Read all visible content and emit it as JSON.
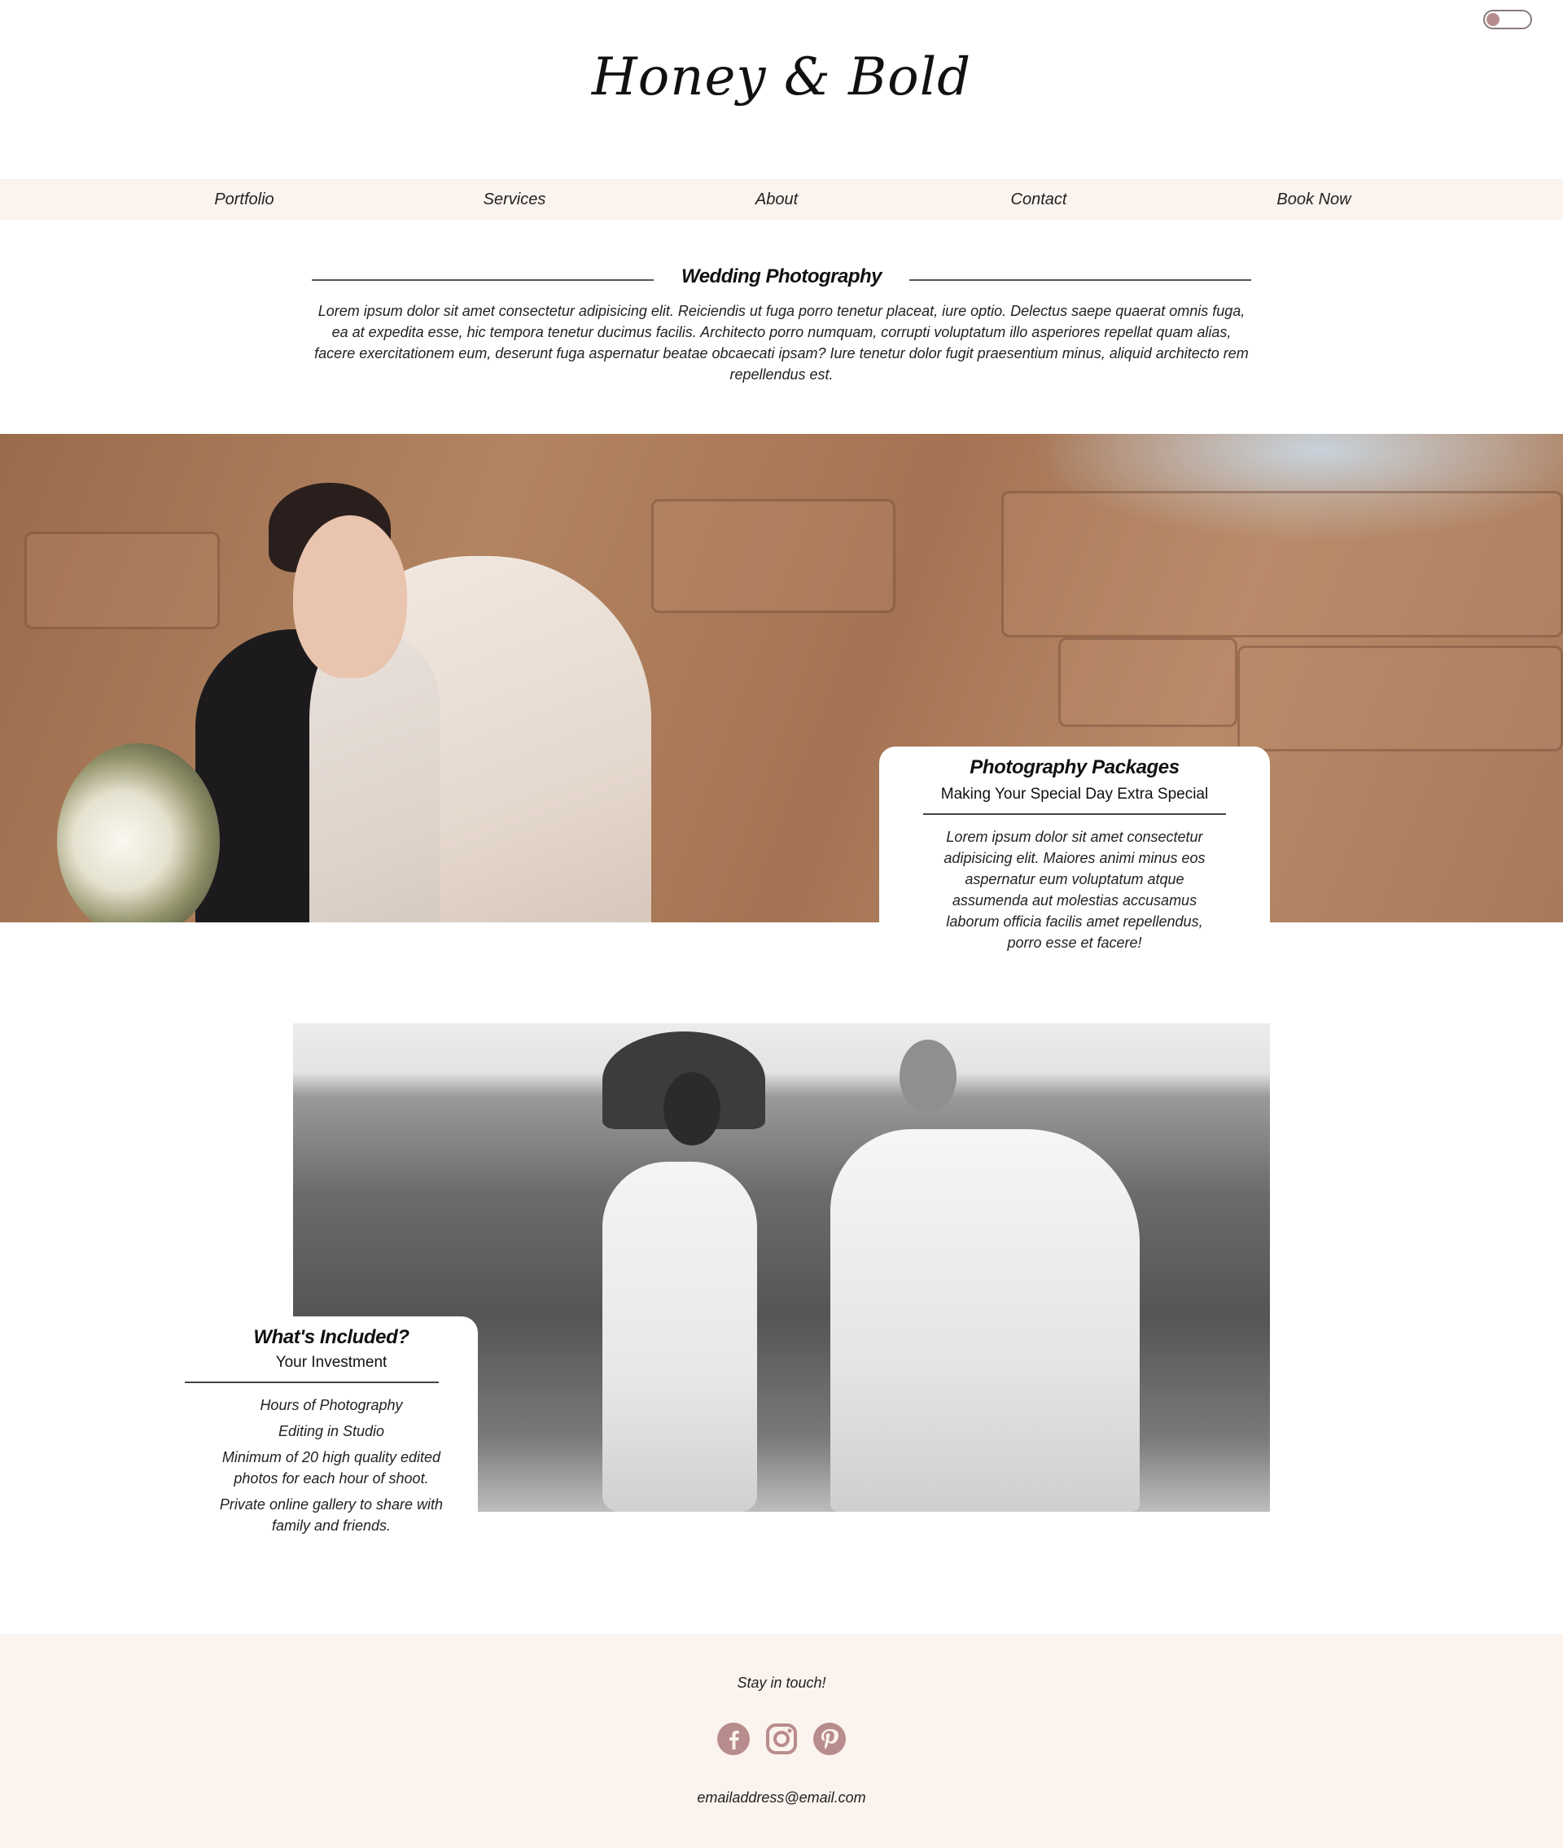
{
  "header": {
    "logo": "Honey & Bold",
    "theme_toggle_icon": "toggle-switch-icon"
  },
  "nav": {
    "items": [
      {
        "label": "Portfolio"
      },
      {
        "label": "Services"
      },
      {
        "label": "About"
      },
      {
        "label": "Contact"
      },
      {
        "label": "Book Now"
      }
    ]
  },
  "intro": {
    "title": "Wedding Photography",
    "body": "Lorem ipsum dolor sit amet consectetur adipisicing elit. Reiciendis ut fuga porro tenetur placeat, iure optio. Delectus saepe quaerat omnis fuga, ea at expedita esse, hic tempora tenetur ducimus facilis. Architecto porro numquam, corrupti voluptatum illo asperiores repellat quam alias, facere exercitationem eum, deserunt fuga aspernatur beatae obcaecati ipsam? Iure tenetur dolor fugit praesentium minus, aliquid architecto rem repellendus est."
  },
  "packages": {
    "title": "Photography Packages",
    "subtitle": "Making Your Special Day Extra Special",
    "body": "Lorem ipsum dolor sit amet consectetur adipisicing elit. Maiores animi minus eos aspernatur eum voluptatum atque assumenda aut molestias accusamus laborum officia facilis amet repellendus, porro esse et facere!"
  },
  "included": {
    "title": "What's Included?",
    "subtitle": "Your Investment",
    "items": [
      "Hours of Photography",
      "Editing in Studio",
      "Minimum of 20 high quality edited photos for each hour of shoot.",
      "Private online gallery to share with family and friends."
    ]
  },
  "footer": {
    "tagline": "Stay in touch!",
    "social": [
      {
        "icon": "facebook-icon"
      },
      {
        "icon": "instagram-icon"
      },
      {
        "icon": "pinterest-icon"
      }
    ],
    "email": "emailaddress@email.com"
  },
  "colors": {
    "accent": "#b88c8c",
    "band_background": "#fbf3ee",
    "text": "#1a1a1a"
  }
}
